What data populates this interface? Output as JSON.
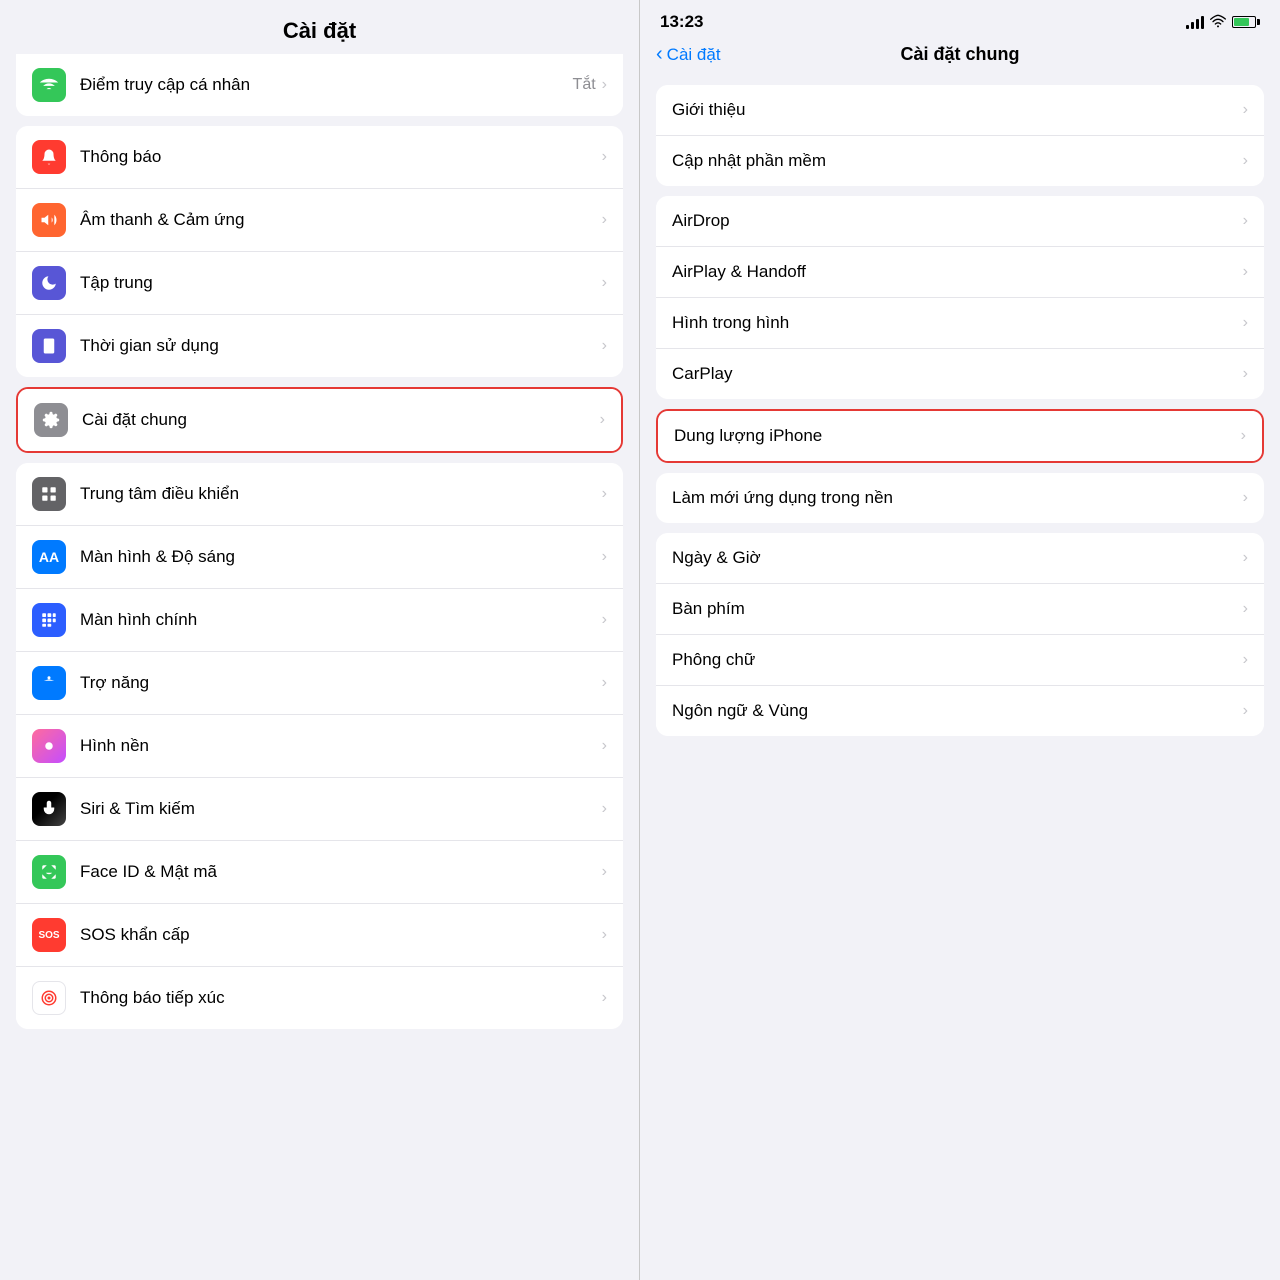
{
  "left": {
    "header": "Cài đặt",
    "top_item": {
      "label": "Điểm truy cập cá nhân",
      "value": "Tắt",
      "icon_color": "green",
      "icon_char": "📶"
    },
    "sections": [
      {
        "items": [
          {
            "id": "thong-bao",
            "label": "Thông báo",
            "icon_bg": "red",
            "icon_char": "🔔"
          },
          {
            "id": "am-thanh",
            "label": "Âm thanh & Cảm ứng",
            "icon_bg": "orange-red",
            "icon_char": "🔊"
          },
          {
            "id": "tap-trung",
            "label": "Tập trung",
            "icon_bg": "purple-dark",
            "icon_char": "🌙"
          },
          {
            "id": "thoi-gian",
            "label": "Thời gian sử dụng",
            "icon_bg": "purple",
            "icon_char": "⏳"
          }
        ]
      },
      {
        "highlighted": true,
        "items": [
          {
            "id": "cai-dat-chung",
            "label": "Cài đặt chung",
            "icon_bg": "gray",
            "icon_char": "⚙️"
          }
        ]
      },
      {
        "items": [
          {
            "id": "trung-tam",
            "label": "Trung tâm điều khiển",
            "icon_bg": "gray-dark",
            "icon_char": "🎛"
          },
          {
            "id": "man-hinh",
            "label": "Màn hình & Độ sáng",
            "icon_bg": "blue",
            "icon_char": "AA"
          },
          {
            "id": "man-hinh-chinh",
            "label": "Màn hình chính",
            "icon_bg": "blue-dark",
            "icon_char": "⊞"
          },
          {
            "id": "tro-nang",
            "label": "Trợ năng",
            "icon_bg": "blue",
            "icon_char": "♿"
          },
          {
            "id": "hinh-nen",
            "label": "Hình nền",
            "icon_bg": "pink",
            "icon_char": "🌸"
          },
          {
            "id": "siri",
            "label": "Siri & Tìm kiếm",
            "icon_bg": "dark",
            "icon_char": "🎙"
          },
          {
            "id": "face-id",
            "label": "Face ID & Mật mã",
            "icon_bg": "green",
            "icon_char": "😊"
          },
          {
            "id": "sos",
            "label": "SOS khẩn cấp",
            "icon_bg": "red",
            "icon_char": "SOS"
          },
          {
            "id": "thong-bao-tiep-xuc",
            "label": "Thông báo tiếp xúc",
            "icon_bg": "white-red",
            "icon_char": "🔴"
          }
        ]
      }
    ]
  },
  "right": {
    "status_time": "13:23",
    "back_label": "Cài đặt",
    "page_title": "Cài đặt chung",
    "sections": [
      {
        "items": [
          {
            "id": "gioi-thieu",
            "label": "Giới thiệu"
          },
          {
            "id": "cap-nhat",
            "label": "Cập nhật phần mềm"
          }
        ]
      },
      {
        "items": [
          {
            "id": "airdrop",
            "label": "AirDrop"
          },
          {
            "id": "airplay",
            "label": "AirPlay & Handoff"
          },
          {
            "id": "hinh-trong-hinh",
            "label": "Hình trong hình"
          },
          {
            "id": "carplay",
            "label": "CarPlay"
          }
        ]
      },
      {
        "highlighted": true,
        "items": [
          {
            "id": "dung-luong",
            "label": "Dung lượng iPhone"
          }
        ]
      },
      {
        "items": [
          {
            "id": "lam-moi",
            "label": "Làm mới ứng dụng trong nền"
          }
        ]
      },
      {
        "items": [
          {
            "id": "ngay-gio",
            "label": "Ngày & Giờ"
          },
          {
            "id": "ban-phim",
            "label": "Bàn phím"
          },
          {
            "id": "phong-chu",
            "label": "Phông chữ"
          },
          {
            "id": "ngon-ngu",
            "label": "Ngôn ngữ & Vùng"
          }
        ]
      }
    ]
  }
}
